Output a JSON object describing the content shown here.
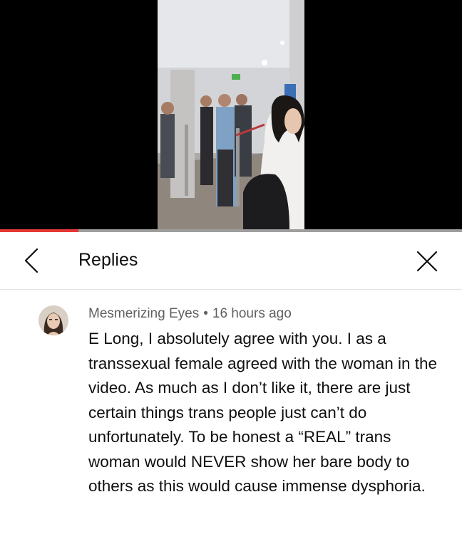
{
  "video": {
    "progress_fraction": 0.17
  },
  "header": {
    "title": "Replies",
    "back_icon": "chevron-left-icon",
    "close_icon": "close-icon"
  },
  "comment": {
    "author": "Mesmerizing Eyes",
    "separator": "•",
    "timestamp": "16 hours ago",
    "text": "E Long, I absolutely agree with you. I as a transsexual female agreed with the woman in the video. As much as I don’t like it, there are just certain things trans people just can’t do unfortunately. To be honest a “REAL” trans woman would NEVER show her bare body to others as this would cause immense dysphoria."
  },
  "colors": {
    "progress": "#e53935",
    "text_primary": "#0f0f0f",
    "text_secondary": "#606060"
  }
}
